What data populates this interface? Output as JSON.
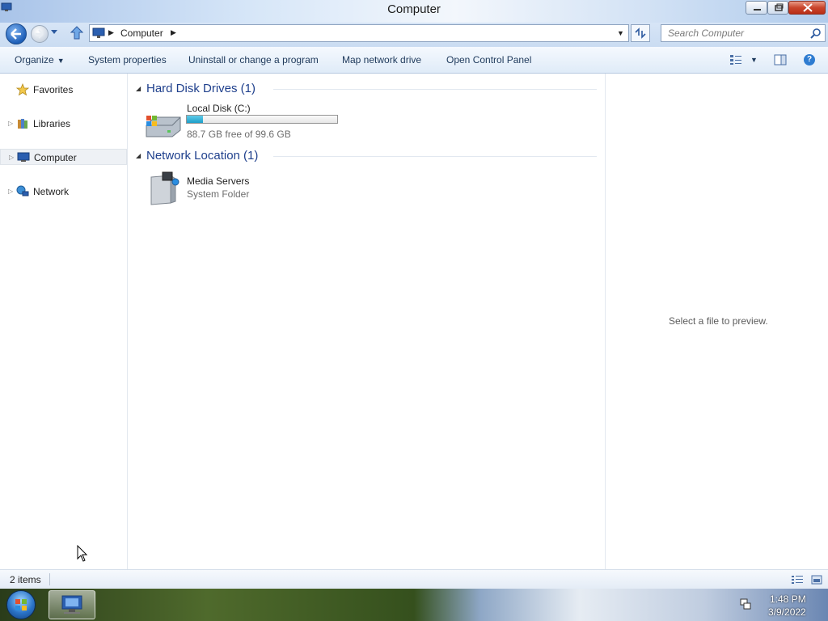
{
  "window": {
    "title": "Computer"
  },
  "address": {
    "crumbs": [
      "Computer"
    ],
    "search_placeholder": "Search Computer"
  },
  "toolbar": {
    "organize": "Organize",
    "system_properties": "System properties",
    "uninstall": "Uninstall or change a program",
    "map_drive": "Map network drive",
    "control_panel": "Open Control Panel"
  },
  "nav": {
    "items": [
      {
        "label": "Favorites",
        "icon": "star-icon"
      },
      {
        "label": "Libraries",
        "icon": "libraries-icon"
      },
      {
        "label": "Computer",
        "icon": "computer-icon"
      },
      {
        "label": "Network",
        "icon": "network-icon"
      }
    ]
  },
  "groups": [
    {
      "title": "Hard Disk Drives (1)",
      "items": [
        {
          "name": "Local Disk (C:)",
          "detail": "88.7 GB free of 99.6 GB",
          "used_fraction": 0.109,
          "icon": "hard-disk-icon"
        }
      ]
    },
    {
      "title": "Network Location (1)",
      "items": [
        {
          "name": "Media Servers",
          "detail": "System Folder",
          "icon": "media-server-icon"
        }
      ]
    }
  ],
  "preview": {
    "text": "Select a file to preview."
  },
  "status": {
    "count": "2 items"
  },
  "taskbar": {
    "time": "1:48 PM",
    "date": "3/9/2022"
  },
  "colors": {
    "accent": "#1e3f8c",
    "capacity_fill": "#1d9fc9",
    "close_button": "#c9452c"
  }
}
